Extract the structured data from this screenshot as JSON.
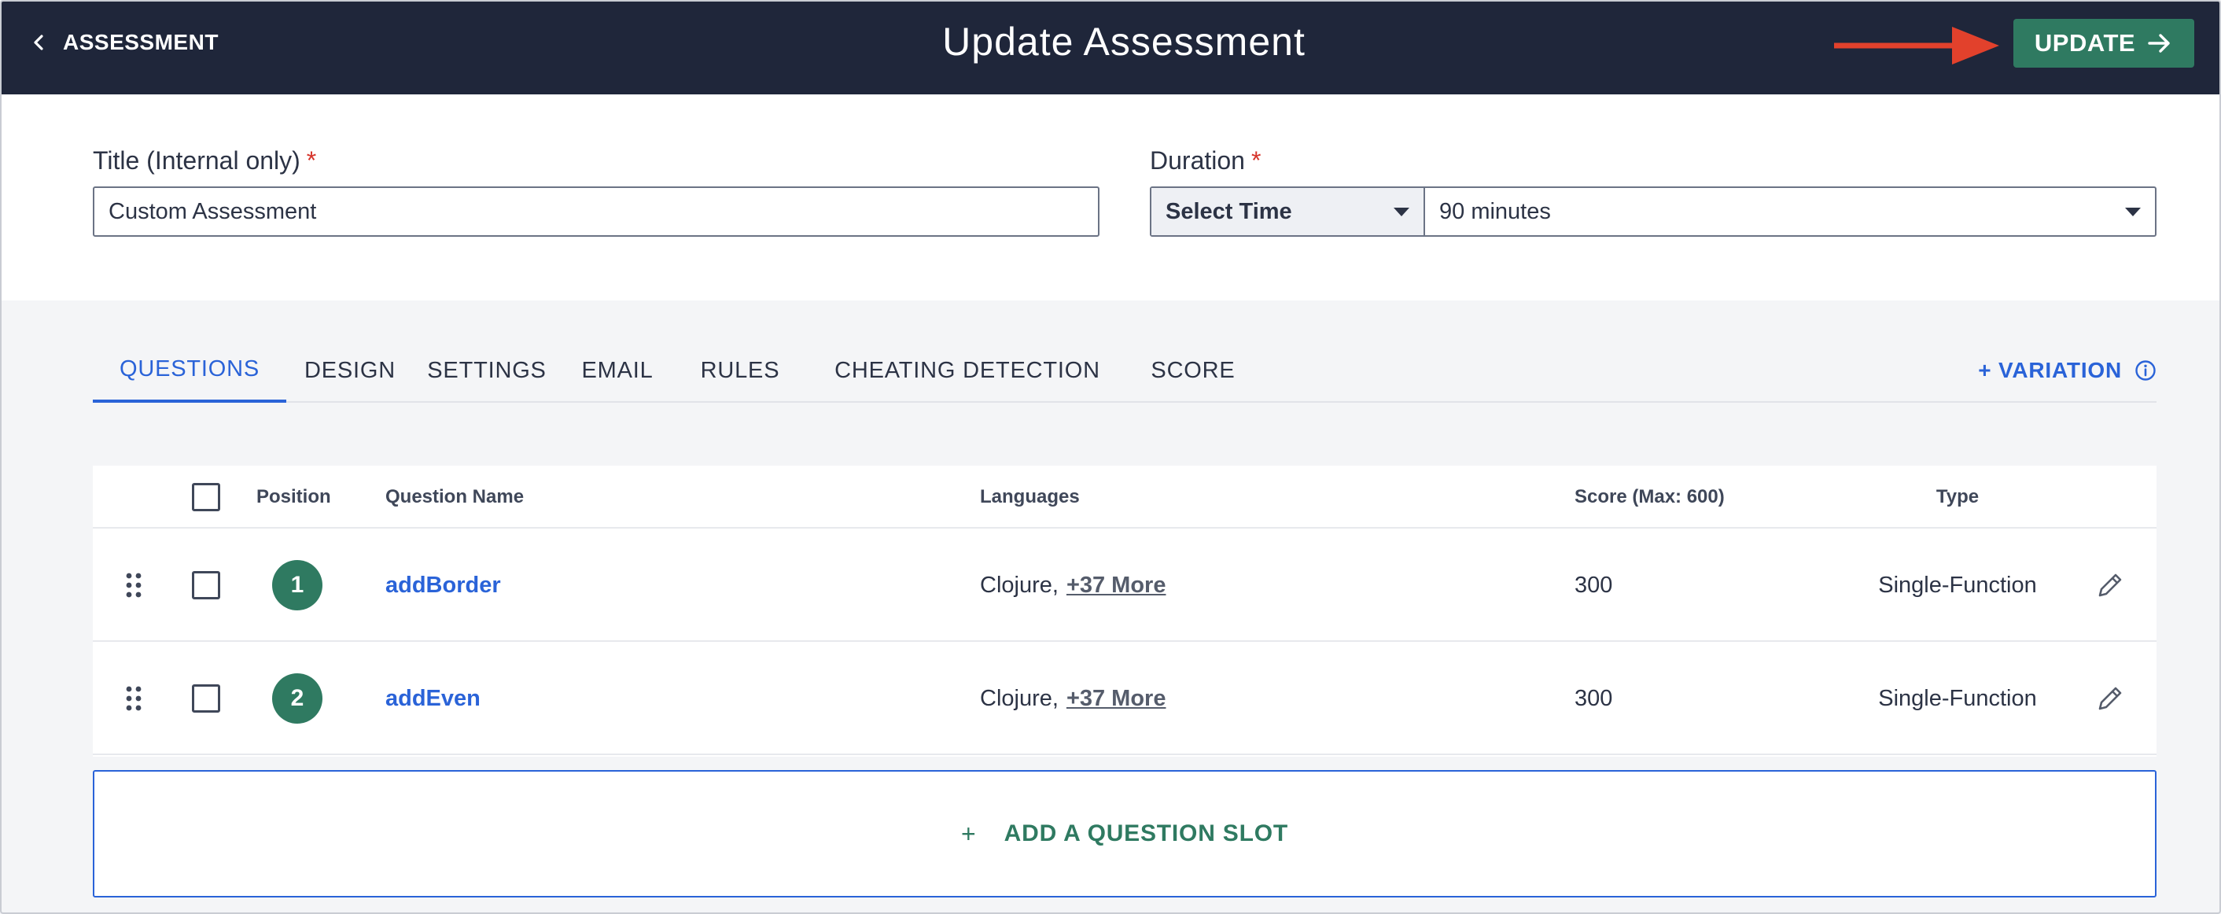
{
  "header": {
    "back_label": "ASSESSMENT",
    "title": "Update Assessment",
    "update_label": "UPDATE"
  },
  "form": {
    "title_label": "Title (Internal only)",
    "title_value": "Custom Assessment",
    "duration_label": "Duration",
    "required_mark": "*",
    "duration_unit": "Select Time",
    "duration_value": "90 minutes"
  },
  "tabs": [
    {
      "label": "QUESTIONS",
      "active": true
    },
    {
      "label": "DESIGN",
      "active": false
    },
    {
      "label": "SETTINGS",
      "active": false
    },
    {
      "label": "EMAIL",
      "active": false
    },
    {
      "label": "RULES",
      "active": false
    },
    {
      "label": "CHEATING DETECTION",
      "active": false
    },
    {
      "label": "SCORE",
      "active": false
    }
  ],
  "variation_label": "+ VARIATION",
  "table": {
    "headers": {
      "position": "Position",
      "question_name": "Question Name",
      "languages": "Languages",
      "score": "Score (Max: 600)",
      "type": "Type"
    },
    "rows": [
      {
        "position": "1",
        "name": "addBorder",
        "language": "Clojure,",
        "more": "+37 More",
        "score": "300",
        "type": "Single-Function"
      },
      {
        "position": "2",
        "name": "addEven",
        "language": "Clojure,",
        "more": "+37 More",
        "score": "300",
        "type": "Single-Function"
      }
    ]
  },
  "add_slot": {
    "plus": "+",
    "label": "ADD A QUESTION SLOT"
  },
  "colors": {
    "header_bg": "#1f263a",
    "accent_green": "#2f7a61",
    "link_blue": "#2a63d8",
    "annotation_red": "#e2412c",
    "required_red": "#d6332a"
  }
}
